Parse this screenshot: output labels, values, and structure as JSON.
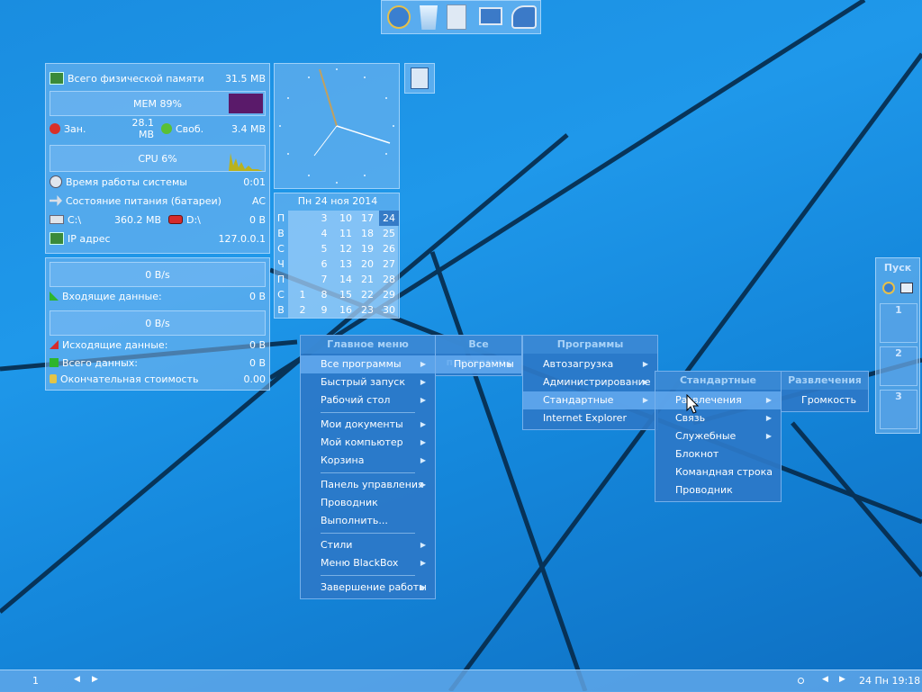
{
  "system": {
    "total_memory_label": "Всего физической памяти",
    "total_memory_value": "31.5 MB",
    "mem_label": "MEM 89%",
    "used_label": "Зан.",
    "used_value": "28.1 MB",
    "free_label": "Своб.",
    "free_value": "3.4 MB",
    "cpu_label": "CPU 6%",
    "uptime_label": "Время работы системы",
    "uptime_value": "0:01",
    "power_label": "Состояние питания (батареи)",
    "power_value": "AC",
    "drive_c_label": "C:\\",
    "drive_c_value": "360.2 MB",
    "drive_d_label": "D:\\",
    "drive_d_value": "0 B",
    "ip_label": "IP адрес",
    "ip_value": "127.0.0.1"
  },
  "network": {
    "in_rate": "0 B/s",
    "in_label": "Входящие данные:",
    "in_value": "0 B",
    "out_rate": "0 B/s",
    "out_label": "Исходящие данные:",
    "out_value": "0 B",
    "total_label": "Всего данных:",
    "total_value": "0 B",
    "cost_label": "Окончательная стоимость",
    "cost_value": "0.00"
  },
  "calendar": {
    "header": "Пн 24 ноя  2014",
    "day_names": [
      "П",
      "В",
      "С",
      "Ч",
      "П",
      "С",
      "В"
    ],
    "cols": [
      [
        "",
        "",
        "",
        "",
        "",
        "1",
        "2"
      ],
      [
        "3",
        "4",
        "5",
        "6",
        "7",
        "8",
        "9"
      ],
      [
        "10",
        "11",
        "12",
        "13",
        "14",
        "15",
        "16"
      ],
      [
        "17",
        "18",
        "19",
        "20",
        "21",
        "22",
        "23"
      ],
      [
        "24",
        "25",
        "26",
        "27",
        "28",
        "29",
        "30"
      ]
    ]
  },
  "menus": {
    "main": {
      "title": "Главное меню",
      "items": [
        "Все программы",
        "Быстрый запуск",
        "Рабочий стол",
        "Мои документы",
        "Мой компьютер",
        "Корзина",
        "Панель управления",
        "Проводник",
        "Выполнить...",
        "Стили",
        "Меню BlackBox",
        "Завершение работы"
      ]
    },
    "all_programs": {
      "title": "Все программы",
      "items": [
        "Программы"
      ]
    },
    "programs": {
      "title": "Программы",
      "items": [
        "Автозагрузка",
        "Администрирование",
        "Стандартные",
        "Internet Explorer"
      ]
    },
    "standard": {
      "title": "Стандартные",
      "items": [
        "Развлечения",
        "Связь",
        "Служебные",
        "Блокнот",
        "Командная строка",
        "Проводник"
      ]
    },
    "entertainment": {
      "title": "Развлечения",
      "items": [
        "Громкость"
      ]
    }
  },
  "sidebar": {
    "title": "Пуск",
    "workspaces": [
      "1",
      "2",
      "3"
    ]
  },
  "taskbar": {
    "workspace": "1",
    "clock": "24 Пн 19:18"
  },
  "colors": {
    "accent": "#1f98ea",
    "panel": "#7db9f0",
    "menu": "#2d78c8"
  }
}
